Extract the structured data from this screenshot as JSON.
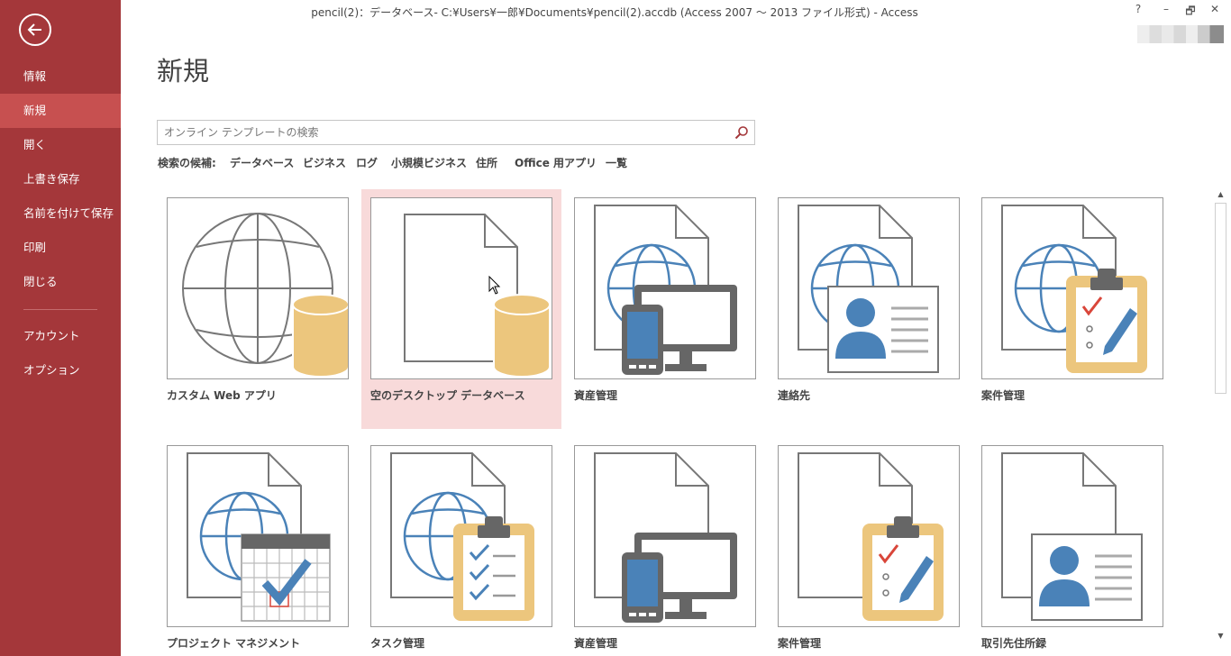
{
  "window": {
    "title": "pencil(2)：データベース- C:¥Users¥一郎¥Documents¥pencil(2).accdb (Access 2007 ～ 2013 ファイル形式) - Access",
    "help": "?",
    "minimize": "–",
    "restore": "🗗",
    "close": "✕"
  },
  "sidebar": {
    "items": [
      {
        "label": "情報"
      },
      {
        "label": "新規"
      },
      {
        "label": "開く"
      },
      {
        "label": "上書き保存"
      },
      {
        "label": "名前を付けて保存"
      },
      {
        "label": "印刷"
      },
      {
        "label": "閉じる"
      },
      {
        "label": "アカウント"
      },
      {
        "label": "オプション"
      }
    ],
    "accent": "#a4373a",
    "active_bg": "#c75050"
  },
  "main": {
    "title": "新規",
    "search": {
      "placeholder": "オンライン テンプレートの検索",
      "value": ""
    },
    "suggest": {
      "label": "検索の候補:",
      "items": [
        "データベース",
        "ビジネス",
        "ログ",
        "小規模ビジネス",
        "住所",
        "Office 用アプリ",
        "一覧"
      ]
    },
    "templates": [
      {
        "label": "カスタム Web アプリ",
        "icon": "globe-database-icon"
      },
      {
        "label": "空のデスクトップ データベース",
        "icon": "blank-document-database-icon"
      },
      {
        "label": "資産管理",
        "icon": "globe-devices-icon"
      },
      {
        "label": "連絡先",
        "icon": "globe-contact-card-icon"
      },
      {
        "label": "案件管理",
        "icon": "globe-clipboard-pencil-icon"
      },
      {
        "label": "プロジェクト マネジメント",
        "icon": "globe-calendar-check-icon"
      },
      {
        "label": "タスク管理",
        "icon": "globe-clipboard-checklist-icon"
      },
      {
        "label": "資産管理",
        "icon": "document-devices-icon"
      },
      {
        "label": "案件管理",
        "icon": "document-clipboard-pencil-icon"
      },
      {
        "label": "取引先住所録",
        "icon": "document-contact-card-icon"
      }
    ]
  }
}
